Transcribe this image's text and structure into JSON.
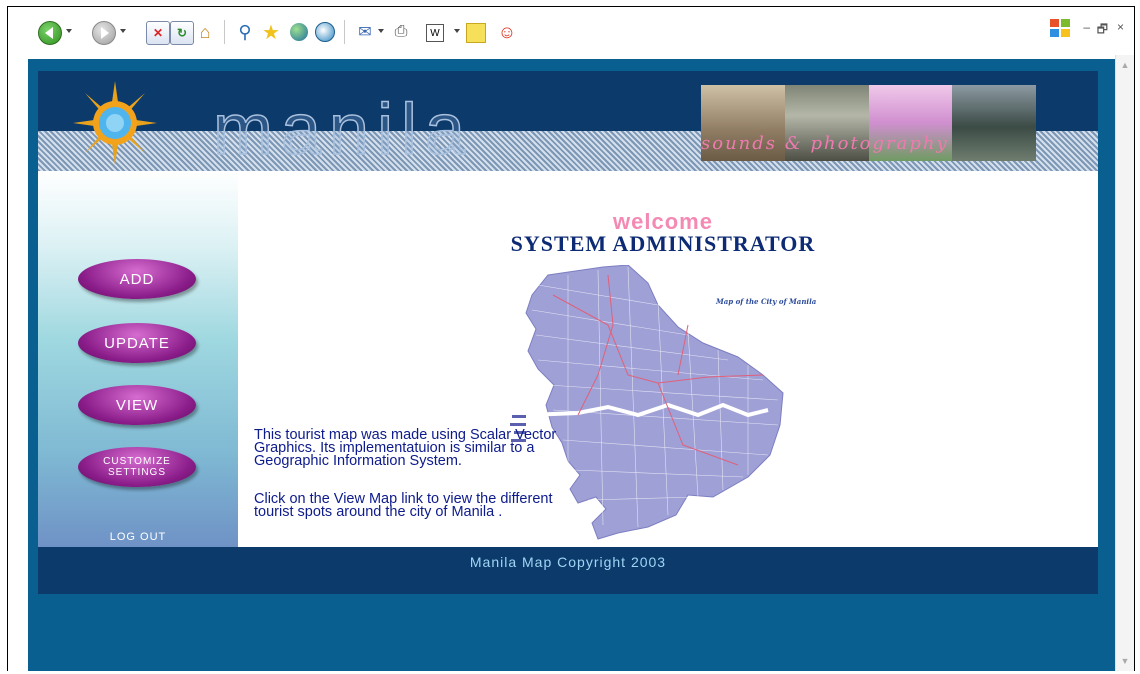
{
  "toolbar": {
    "icons": [
      "back-icon",
      "forward-icon",
      "stop-icon",
      "refresh-icon",
      "home-icon",
      "search-icon",
      "favorites-icon",
      "media-icon",
      "history-icon",
      "mail-icon",
      "print-icon",
      "word-icon",
      "note-icon",
      "messenger-icon"
    ]
  },
  "window_controls": {
    "minimize": "–",
    "restore": "🗗",
    "close": "×"
  },
  "header": {
    "logo_text": "manila",
    "photo_caption": "sounds & photography"
  },
  "sidebar": {
    "add_label": "ADD",
    "update_label": "UPDATE",
    "view_label": "VIEW",
    "customize_line1": "CUSTOMIZE",
    "customize_line2": "SETTINGS",
    "logout_label": "LOG OUT"
  },
  "main": {
    "welcome": "welcome",
    "admin_title": "SYSTEM ADMINISTRATOR",
    "map_title": "Map of the City of Manila",
    "description_1": "This tourist map was made using Scalar Vector Graphics. Its implementatuion is similar to a Geographic Information System.",
    "description_2": "Click on the View Map link to view the different tourist spots around the city of Manila ."
  },
  "footer": {
    "copyright": "Manila Map Copyright  2003"
  },
  "colors": {
    "page_bg": "#085f90",
    "header_bg": "#0b3a6b",
    "button_purple": "#8b1d8a",
    "welcome_pink": "#f48ab4",
    "admin_navy": "#0d2a74"
  }
}
